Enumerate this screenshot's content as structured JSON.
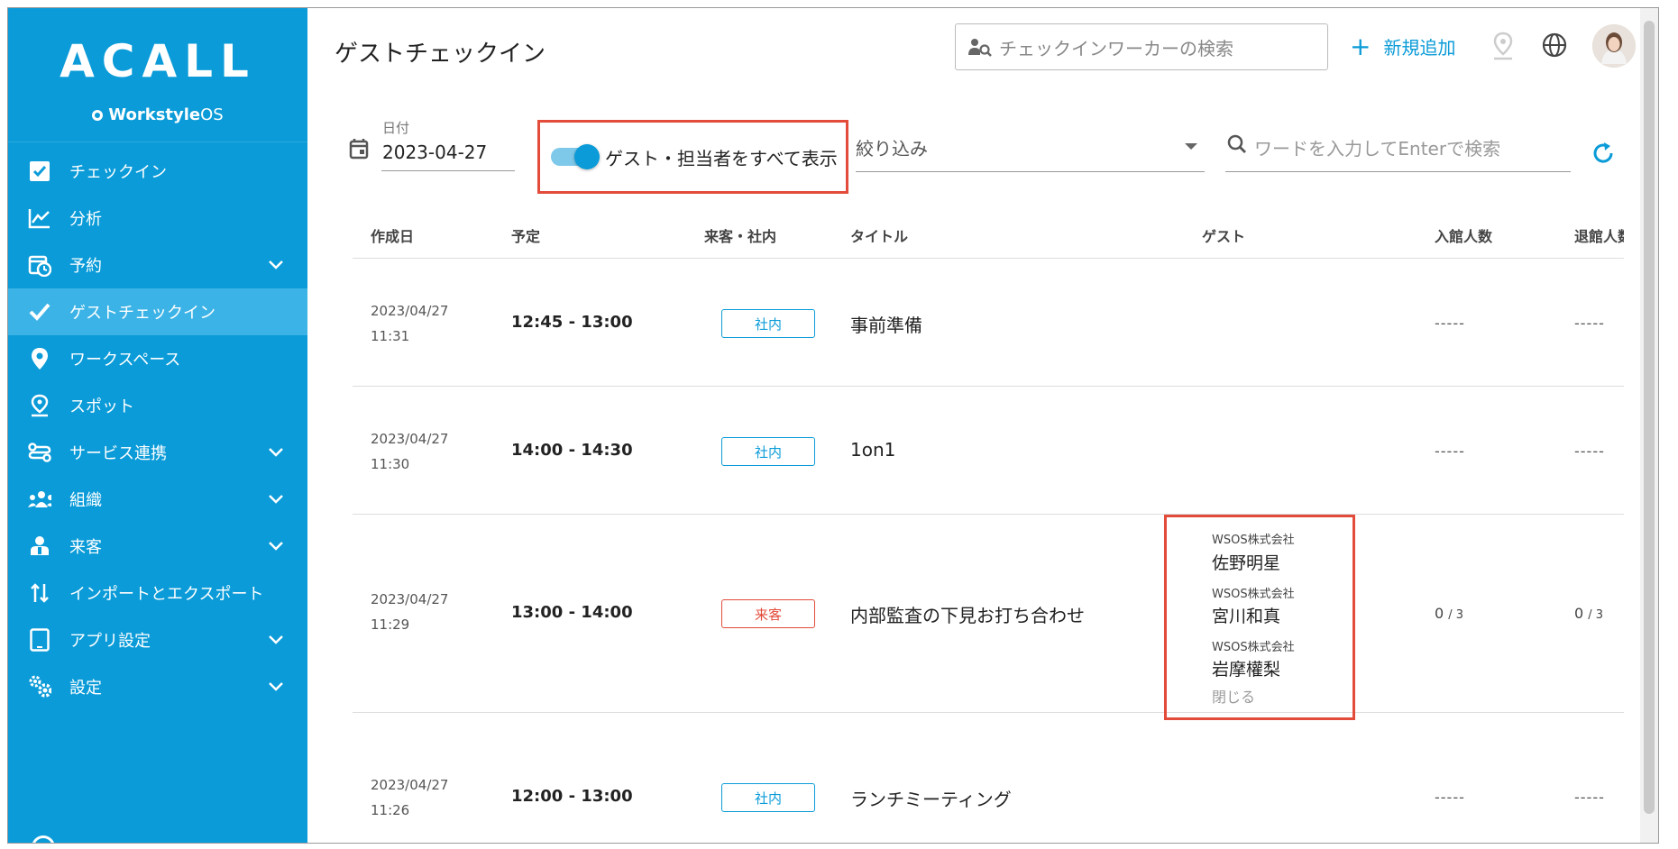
{
  "sidebar": {
    "logo": "ACALL",
    "subtitle_bold": "Workstyle",
    "subtitle_rest": "OS",
    "items": [
      {
        "label": "チェックイン",
        "icon": "checkbox-icon",
        "expandable": false
      },
      {
        "label": "分析",
        "icon": "chart-icon",
        "expandable": false
      },
      {
        "label": "予約",
        "icon": "calendar-clock-icon",
        "expandable": true
      },
      {
        "label": "ゲストチェックイン",
        "icon": "check-icon",
        "expandable": false,
        "active": true
      },
      {
        "label": "ワークスペース",
        "icon": "location-pin-icon",
        "expandable": false
      },
      {
        "label": "スポット",
        "icon": "spot-pin-icon",
        "expandable": false
      },
      {
        "label": "サービス連携",
        "icon": "integration-icon",
        "expandable": true
      },
      {
        "label": "組織",
        "icon": "group-icon",
        "expandable": true
      },
      {
        "label": "来客",
        "icon": "visitor-icon",
        "expandable": true
      },
      {
        "label": "インポートとエクスポート",
        "icon": "import-export-icon",
        "expandable": false
      },
      {
        "label": "アプリ設定",
        "icon": "tablet-icon",
        "expandable": true
      },
      {
        "label": "設定",
        "icon": "gears-icon",
        "expandable": true
      }
    ]
  },
  "header": {
    "title": "ゲストチェックイン",
    "worker_search_placeholder": "チェックインワーカーの検索",
    "add_new_label": "新規追加"
  },
  "filters": {
    "date_label": "日付",
    "date_value": "2023-04-27",
    "toggle_label": "ゲスト・担当者をすべて表示",
    "toggle_on": true,
    "narrow_placeholder": "絞り込み",
    "word_search_placeholder": "ワードを入力してEnterで検索"
  },
  "table": {
    "columns": [
      "作成日",
      "予定",
      "来客・社内",
      "タイトル",
      "ゲスト",
      "入館人数",
      "退館人数"
    ],
    "rows": [
      {
        "created_date": "2023/04/27",
        "created_time": "11:31",
        "schedule": "12:45 - 13:00",
        "type": "社内",
        "title": "事前準備",
        "entered": "-----",
        "exited": "-----"
      },
      {
        "created_date": "2023/04/27",
        "created_time": "11:30",
        "schedule": "14:00 - 14:30",
        "type": "社内",
        "title": "1on1",
        "entered": "-----",
        "exited": "-----"
      },
      {
        "created_date": "2023/04/27",
        "created_time": "11:29",
        "schedule": "13:00 - 14:00",
        "type": "来客",
        "title": "内部監査の下見お打ち合わせ",
        "guests": [
          {
            "company": "WSOS株式会社",
            "name": "佐野明星"
          },
          {
            "company": "WSOS株式会社",
            "name": "宮川和真"
          },
          {
            "company": "WSOS株式会社",
            "name": "岩摩權梨"
          }
        ],
        "close_label": "閉じる",
        "entered_num": "0",
        "entered_den": "3",
        "exited_num": "0",
        "exited_den": "3"
      },
      {
        "created_date": "2023/04/27",
        "created_time": "11:26",
        "schedule": "12:00 - 13:00",
        "type": "社内",
        "title": "ランチミーティング",
        "entered": "-----",
        "exited": "-----"
      }
    ]
  },
  "colors": {
    "accent": "#0a9bd8",
    "highlight": "#e34b3a",
    "active_item": "#3cb3e6"
  }
}
